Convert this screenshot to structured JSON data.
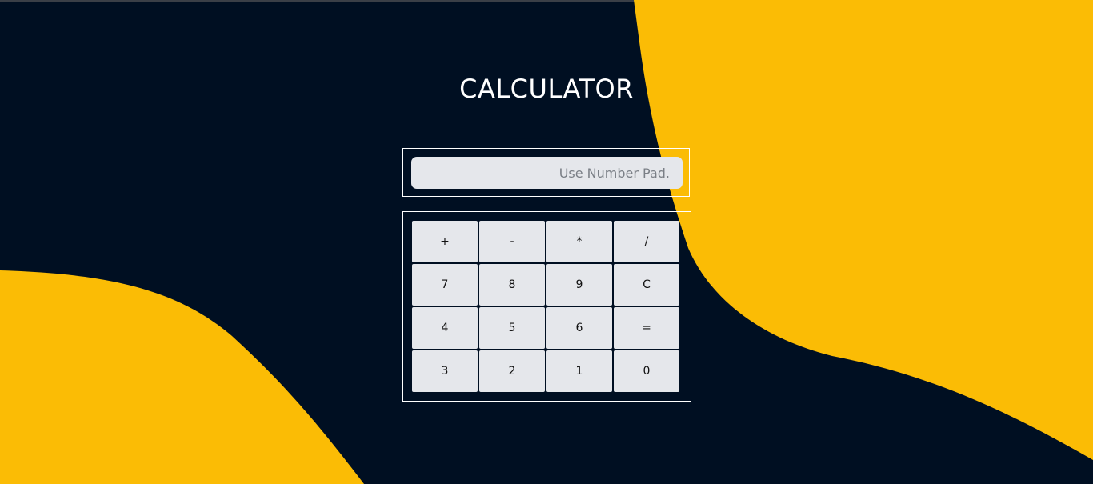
{
  "colors": {
    "background": "#000f22",
    "accent": "#fbbc05",
    "key_background": "#e5e7eb",
    "frame_border": "#ffffff"
  },
  "page": {
    "title": "CALCULATOR"
  },
  "display": {
    "value": "",
    "placeholder": "Use Number Pad."
  },
  "keypad": {
    "rows": [
      [
        "+",
        "-",
        "*",
        "/"
      ],
      [
        "7",
        "8",
        "9",
        "C"
      ],
      [
        "4",
        "5",
        "6",
        "="
      ],
      [
        "3",
        "2",
        "1",
        "0"
      ]
    ]
  }
}
